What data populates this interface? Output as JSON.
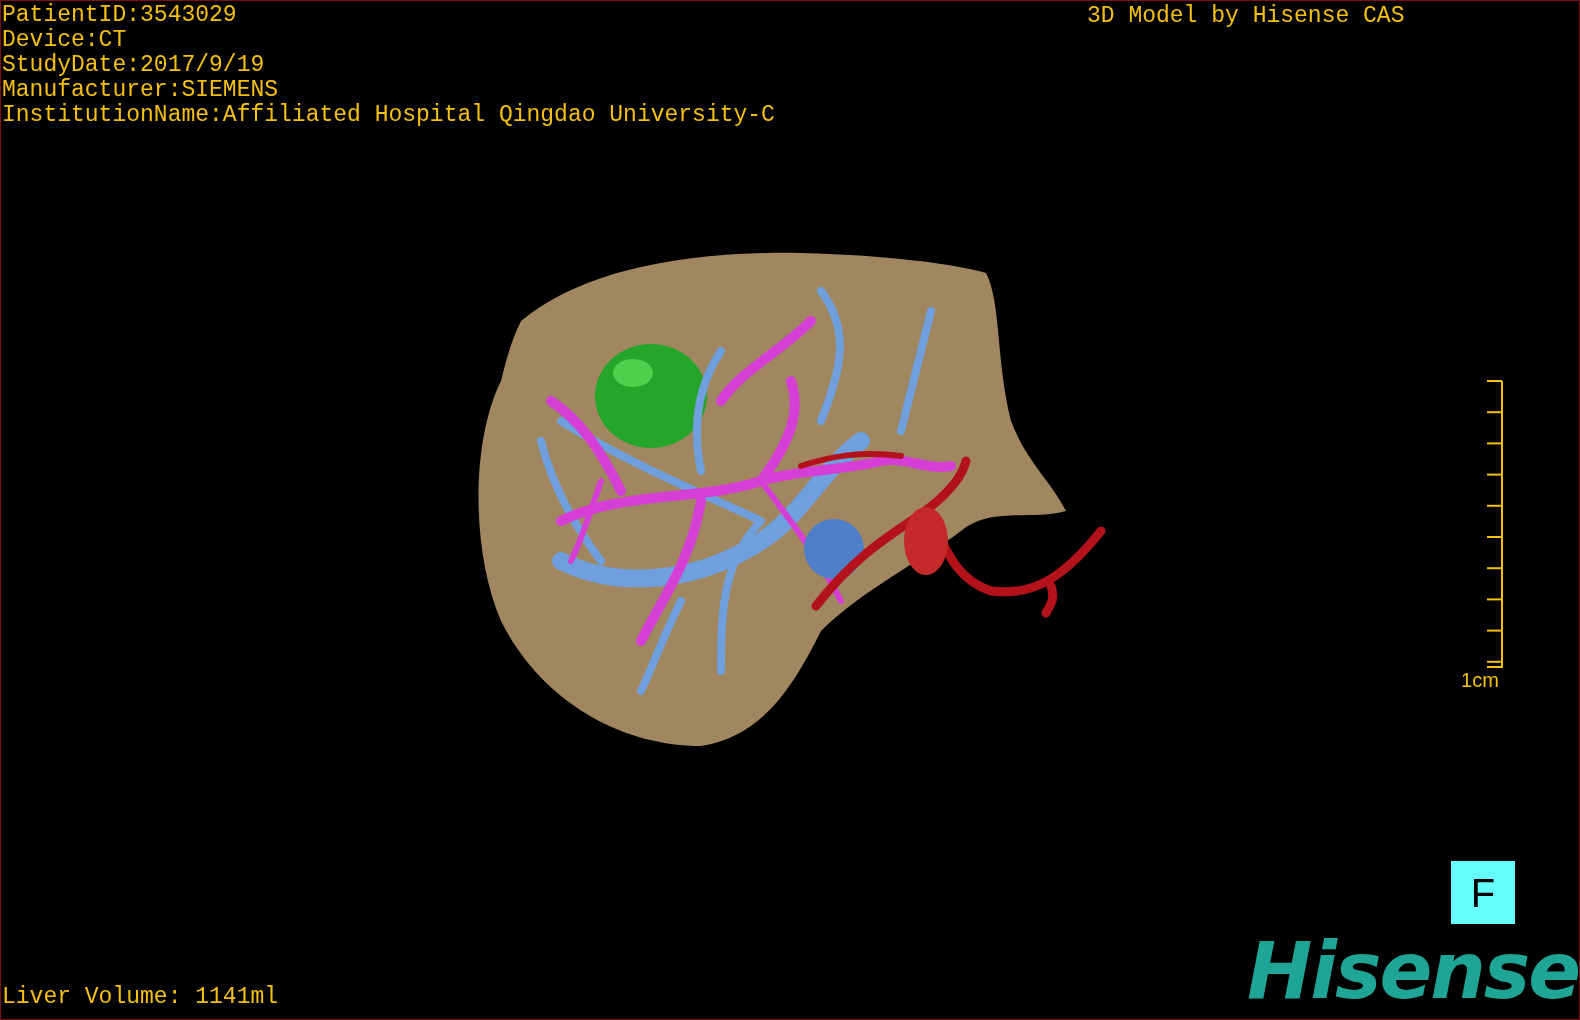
{
  "info_lines": [
    "PatientID:3543029",
    "Device:CT",
    "StudyDate:2017/9/19",
    "Manufacturer:SIEMENS",
    "InstitutionName:Affiliated Hospital Qingdao University-C"
  ],
  "title": "3D Model by Hisense CAS",
  "scale_bar": {
    "label": "1cm"
  },
  "orientation": "F",
  "liver_volume": "Liver Volume: 1141ml",
  "logo": "Hisense"
}
